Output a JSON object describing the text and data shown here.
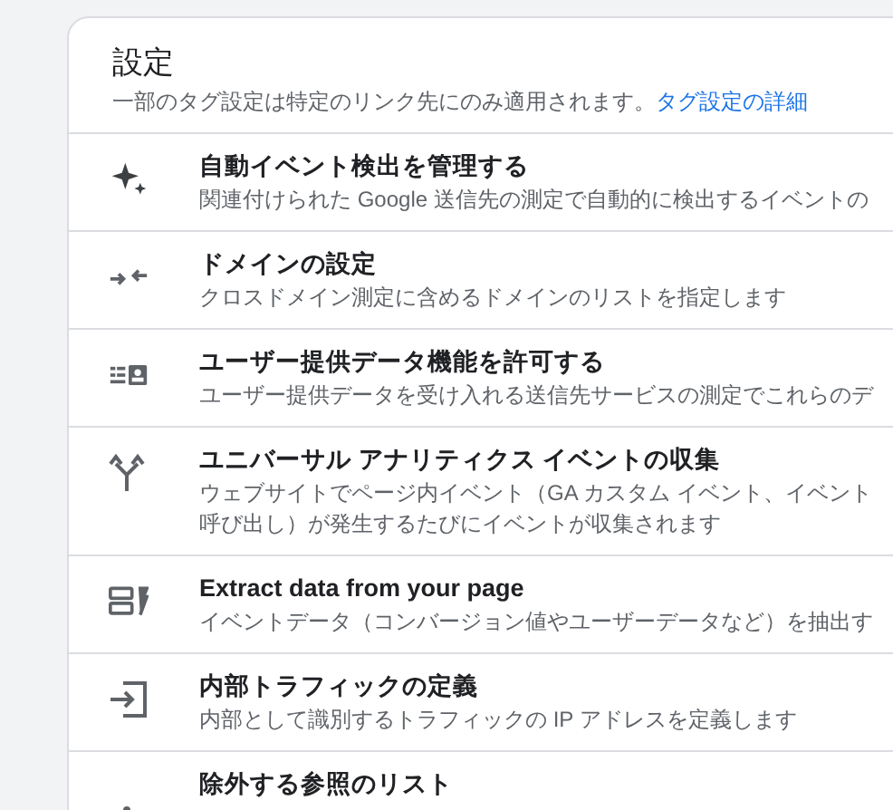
{
  "header": {
    "title": "設定",
    "description": "一部のタグ設定は特定のリンク先にのみ適用されます。",
    "link": "タグ設定の詳細"
  },
  "settings": [
    {
      "title": "自動イベント検出を管理する",
      "lines": [
        "関連付けられた Google 送信先の測定で自動的に検出するイベントの"
      ]
    },
    {
      "title": "ドメインの設定",
      "lines": [
        "クロスドメイン測定に含めるドメインのリストを指定します"
      ]
    },
    {
      "title": "ユーザー提供データ機能を許可する",
      "lines": [
        "ユーザー提供データを受け入れる送信先サービスの測定でこれらのデ"
      ]
    },
    {
      "title": "ユニバーサル アナリティクス イベントの収集",
      "lines": [
        "ウェブサイトでページ内イベント（GA カスタム イベント、イベント",
        "呼び出し）が発生するたびにイベントが収集されます"
      ]
    },
    {
      "title": "Extract data from your page",
      "lines": [
        "イベントデータ（コンバージョン値やユーザーデータなど）を抽出す"
      ]
    },
    {
      "title": "内部トラフィックの定義",
      "lines": [
        "内部として識別するトラフィックの IP アドレスを定義します"
      ]
    },
    {
      "title": "除外する参照のリスト"
    }
  ]
}
